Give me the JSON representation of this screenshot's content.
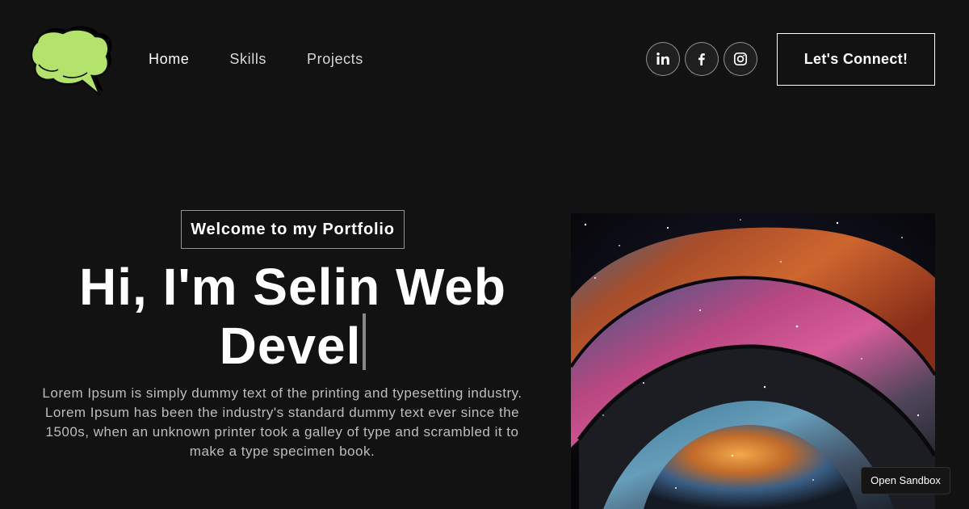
{
  "nav": {
    "links": [
      "Home",
      "Skills",
      "Projects"
    ],
    "active_link": "Home",
    "social": [
      "linkedin-icon",
      "facebook-icon",
      "instagram-icon"
    ],
    "connect_label": "Let's Connect!"
  },
  "hero": {
    "tagline": "Welcome to my Portfolio",
    "headline_line1": "Hi, I'm Selin Web",
    "headline_line2": "Devel",
    "intro": "Lorem Ipsum is simply dummy text of the printing and typesetting industry. Lorem Ipsum has been the industry's standard dummy text ever since the 1500s, when an unknown printer took a galley of type and scrambled it to make a type specimen book."
  },
  "sandbox_label": "Open Sandbox",
  "colors": {
    "background": "#121212",
    "logo_green": "#b3e36c",
    "text": "#ffffff"
  }
}
